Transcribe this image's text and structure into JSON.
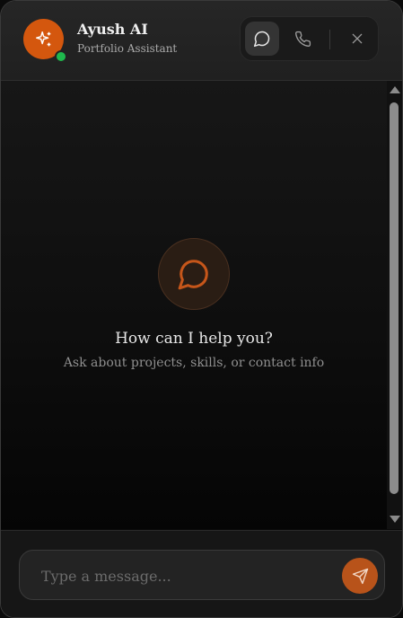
{
  "header": {
    "title": "Ayush AI",
    "subtitle": "Portfolio Assistant",
    "avatar_icon": "sparkles-icon",
    "status": "online",
    "controls": [
      {
        "name": "chat-mode-button",
        "icon": "chat-bubble-icon",
        "active": true
      },
      {
        "name": "call-button",
        "icon": "phone-icon",
        "active": false
      },
      {
        "name": "close-button",
        "icon": "close-icon",
        "active": false
      }
    ]
  },
  "empty_state": {
    "icon": "chat-bubble-icon",
    "title": "How can I help you?",
    "subtitle": "Ask about projects, skills, or contact info"
  },
  "composer": {
    "placeholder": "Type a message...",
    "value": "",
    "send_icon": "send-icon"
  },
  "colors": {
    "accent": "#d4570e",
    "status_online": "#1fb84d",
    "background": "#0b0b0b"
  }
}
